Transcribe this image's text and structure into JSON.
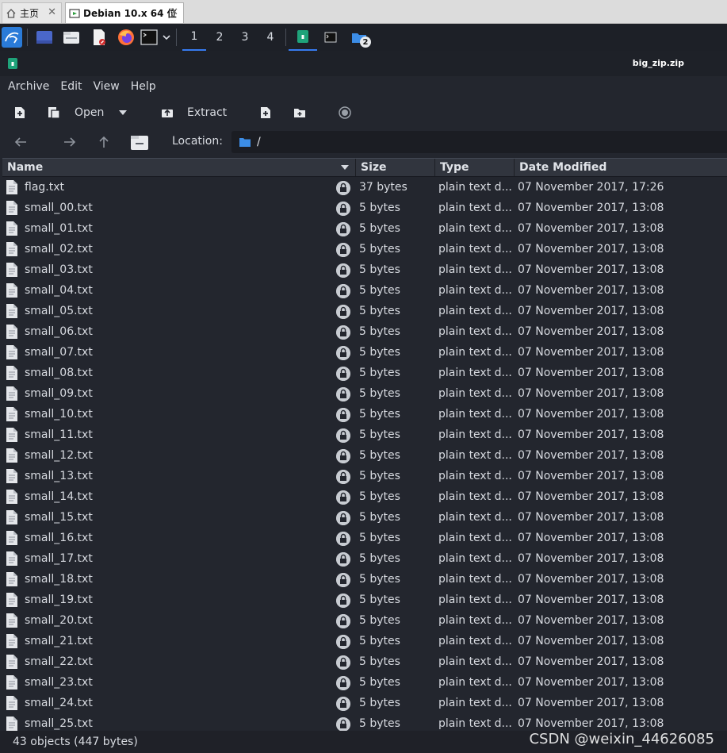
{
  "vm_tabs": {
    "home_label": "主页",
    "debian_label": "Debian 10.x 64 位",
    "close_glyph": "✕"
  },
  "panel": {
    "workspaces": [
      "1",
      "2",
      "3",
      "4"
    ],
    "badge": "2"
  },
  "window": {
    "title": "big_zip.zip"
  },
  "menu": [
    "Archive",
    "Edit",
    "View",
    "Help"
  ],
  "toolbar": {
    "open_label": "Open",
    "extract_label": "Extract"
  },
  "location": {
    "label": "Location:",
    "path": "/"
  },
  "columns": {
    "name": "Name",
    "size": "Size",
    "type": "Type",
    "date": "Date Modified"
  },
  "files": [
    {
      "name": "flag.txt",
      "size": "37 bytes",
      "type": "plain text d...",
      "date": "07 November 2017, 17:26"
    },
    {
      "name": "small_00.txt",
      "size": "5 bytes",
      "type": "plain text d...",
      "date": "07 November 2017, 13:08"
    },
    {
      "name": "small_01.txt",
      "size": "5 bytes",
      "type": "plain text d...",
      "date": "07 November 2017, 13:08"
    },
    {
      "name": "small_02.txt",
      "size": "5 bytes",
      "type": "plain text d...",
      "date": "07 November 2017, 13:08"
    },
    {
      "name": "small_03.txt",
      "size": "5 bytes",
      "type": "plain text d...",
      "date": "07 November 2017, 13:08"
    },
    {
      "name": "small_04.txt",
      "size": "5 bytes",
      "type": "plain text d...",
      "date": "07 November 2017, 13:08"
    },
    {
      "name": "small_05.txt",
      "size": "5 bytes",
      "type": "plain text d...",
      "date": "07 November 2017, 13:08"
    },
    {
      "name": "small_06.txt",
      "size": "5 bytes",
      "type": "plain text d...",
      "date": "07 November 2017, 13:08"
    },
    {
      "name": "small_07.txt",
      "size": "5 bytes",
      "type": "plain text d...",
      "date": "07 November 2017, 13:08"
    },
    {
      "name": "small_08.txt",
      "size": "5 bytes",
      "type": "plain text d...",
      "date": "07 November 2017, 13:08"
    },
    {
      "name": "small_09.txt",
      "size": "5 bytes",
      "type": "plain text d...",
      "date": "07 November 2017, 13:08"
    },
    {
      "name": "small_10.txt",
      "size": "5 bytes",
      "type": "plain text d...",
      "date": "07 November 2017, 13:08"
    },
    {
      "name": "small_11.txt",
      "size": "5 bytes",
      "type": "plain text d...",
      "date": "07 November 2017, 13:08"
    },
    {
      "name": "small_12.txt",
      "size": "5 bytes",
      "type": "plain text d...",
      "date": "07 November 2017, 13:08"
    },
    {
      "name": "small_13.txt",
      "size": "5 bytes",
      "type": "plain text d...",
      "date": "07 November 2017, 13:08"
    },
    {
      "name": "small_14.txt",
      "size": "5 bytes",
      "type": "plain text d...",
      "date": "07 November 2017, 13:08"
    },
    {
      "name": "small_15.txt",
      "size": "5 bytes",
      "type": "plain text d...",
      "date": "07 November 2017, 13:08"
    },
    {
      "name": "small_16.txt",
      "size": "5 bytes",
      "type": "plain text d...",
      "date": "07 November 2017, 13:08"
    },
    {
      "name": "small_17.txt",
      "size": "5 bytes",
      "type": "plain text d...",
      "date": "07 November 2017, 13:08"
    },
    {
      "name": "small_18.txt",
      "size": "5 bytes",
      "type": "plain text d...",
      "date": "07 November 2017, 13:08"
    },
    {
      "name": "small_19.txt",
      "size": "5 bytes",
      "type": "plain text d...",
      "date": "07 November 2017, 13:08"
    },
    {
      "name": "small_20.txt",
      "size": "5 bytes",
      "type": "plain text d...",
      "date": "07 November 2017, 13:08"
    },
    {
      "name": "small_21.txt",
      "size": "5 bytes",
      "type": "plain text d...",
      "date": "07 November 2017, 13:08"
    },
    {
      "name": "small_22.txt",
      "size": "5 bytes",
      "type": "plain text d...",
      "date": "07 November 2017, 13:08"
    },
    {
      "name": "small_23.txt",
      "size": "5 bytes",
      "type": "plain text d...",
      "date": "07 November 2017, 13:08"
    },
    {
      "name": "small_24.txt",
      "size": "5 bytes",
      "type": "plain text d...",
      "date": "07 November 2017, 13:08"
    },
    {
      "name": "small_25.txt",
      "size": "5 bytes",
      "type": "plain text d...",
      "date": "07 November 2017, 13:08"
    }
  ],
  "status": "43 objects (447 bytes)",
  "watermark": "CSDN @weixin_44626085",
  "colors": {
    "background": "#23262e",
    "accent": "#367bf0",
    "text": "#d7dae0"
  }
}
